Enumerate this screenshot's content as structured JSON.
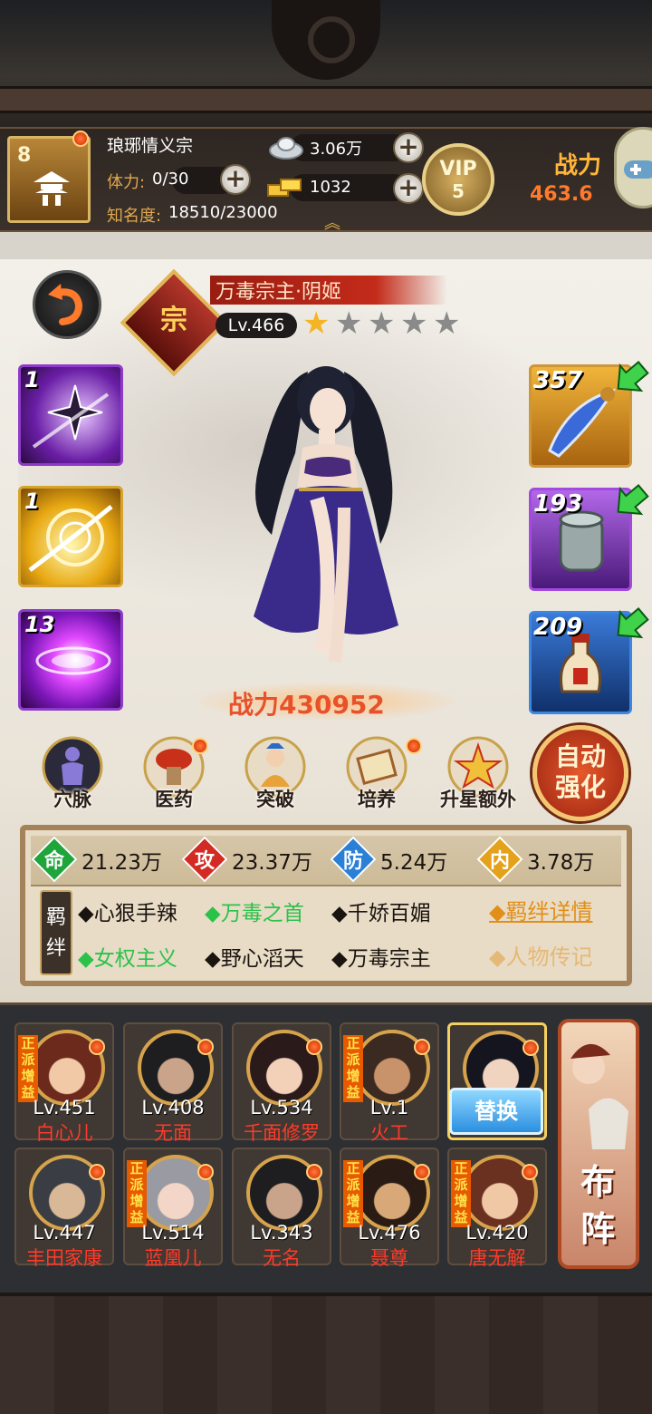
{
  "header": {
    "player_level": "8",
    "guild_name": "琅琊情义宗",
    "stamina_label": "体力:",
    "stamina_value": "0/30",
    "fame_label": "知名度:",
    "fame_value": "18510/23000",
    "silver": "3.06万",
    "gold": "1032",
    "vip_label": "VIP",
    "vip_level": "5",
    "power_label": "战力",
    "power_value": "463.6"
  },
  "hero": {
    "rank_glyph": "宗",
    "name": "万毒宗主·阴姬",
    "level": "Lv.466",
    "stars_filled": 1,
    "stars_total": 5,
    "power": "战力430952"
  },
  "skills": [
    {
      "level": "1",
      "icon": "shuriken-skill-icon"
    },
    {
      "level": "1",
      "icon": "golden-swirl-skill-icon"
    },
    {
      "level": "13",
      "icon": "pink-vortex-skill-icon"
    }
  ],
  "equipment": [
    {
      "level": "357",
      "icon": "blade-weapon-icon"
    },
    {
      "level": "193",
      "icon": "jade-bracer-icon"
    },
    {
      "level": "209",
      "icon": "medicine-bottle-icon"
    }
  ],
  "menu": [
    {
      "label": "穴脉",
      "icon": "meridian-icon",
      "badge": false
    },
    {
      "label": "医药",
      "icon": "medicine-icon",
      "badge": true
    },
    {
      "label": "突破",
      "icon": "breakthrough-icon",
      "badge": false
    },
    {
      "label": "培养",
      "icon": "cultivate-scroll-icon",
      "badge": true
    },
    {
      "label": "升星额外",
      "icon": "star-up-icon",
      "badge": false
    }
  ],
  "auto_strengthen": {
    "line1": "自动",
    "line2": "强化"
  },
  "stats": [
    {
      "key": "命",
      "value": "21.23万",
      "color": "#1fa53a"
    },
    {
      "key": "攻",
      "value": "23.37万",
      "color": "#d42a24"
    },
    {
      "key": "防",
      "value": "5.24万",
      "color": "#2a7fd6"
    },
    {
      "key": "内",
      "value": "3.78万",
      "color": "#e4a21c"
    }
  ],
  "bond_label": "羁绊",
  "bonds": [
    {
      "text": "◆心狠手辣",
      "active": false
    },
    {
      "text": "◆万毒之首",
      "active": true
    },
    {
      "text": "◆千娇百媚",
      "active": false
    },
    {
      "text": "◆女权主义",
      "active": true
    },
    {
      "text": "◆野心滔天",
      "active": false
    },
    {
      "text": "◆万毒宗主",
      "active": false
    }
  ],
  "links": {
    "bond_detail": "◆羁绊详情",
    "biography": "◆人物传记"
  },
  "roster": [
    {
      "level": "Lv.451",
      "name": "白心儿",
      "tag": "正派增益",
      "hair": "#6b2a1c",
      "skin": "#f2c9a6"
    },
    {
      "level": "Lv.408",
      "name": "无面",
      "tag": "",
      "hair": "#1e1e20",
      "skin": "#c9a48a"
    },
    {
      "level": "Lv.534",
      "name": "千面修罗",
      "tag": "",
      "hair": "#2a1a1a",
      "skin": "#f3d0b8"
    },
    {
      "level": "Lv.1",
      "name": "火工",
      "tag": "正派增益",
      "hair": "#3a2a22",
      "skin": "#c8926a"
    },
    {
      "level": "",
      "name": "",
      "tag": "",
      "hair": "#151520",
      "skin": "#f1d4c0"
    },
    {
      "level": "Lv.447",
      "name": "丰田家康",
      "tag": "",
      "hair": "#3a3d44",
      "skin": "#d8b896"
    },
    {
      "level": "Lv.514",
      "name": "蓝凰儿",
      "tag": "正派增益",
      "hair": "#9a9aa2",
      "skin": "#f3d6c8"
    },
    {
      "level": "Lv.343",
      "name": "无名",
      "tag": "",
      "hair": "#1e1e20",
      "skin": "#c9a48a"
    },
    {
      "level": "Lv.476",
      "name": "聂尊",
      "tag": "正派增益",
      "hair": "#2a1c14",
      "skin": "#d8a878"
    },
    {
      "level": "Lv.420",
      "name": "唐无解",
      "tag": "正派增益",
      "hair": "#6a3020",
      "skin": "#f0c8a6"
    }
  ],
  "swap_label": "替换",
  "formation": {
    "line1": "布",
    "line2": "阵"
  }
}
